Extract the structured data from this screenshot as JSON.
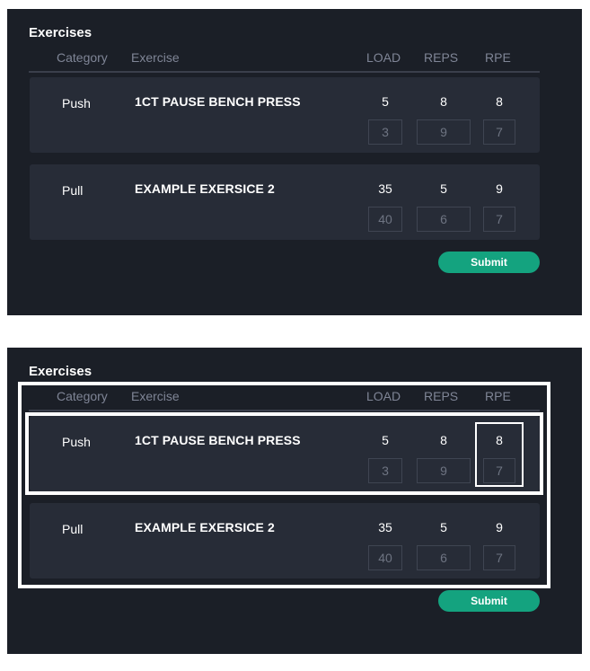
{
  "panels": [
    {
      "title": "Exercises",
      "columns": {
        "category": "Category",
        "exercise": "Exercise",
        "load": "LOAD",
        "reps": "REPS",
        "rpe": "RPE"
      },
      "rows": [
        {
          "category": "Push",
          "exercise": "1CT PAUSE BENCH PRESS",
          "load": "5",
          "reps": "8",
          "rpe": "8",
          "load_input": "3",
          "reps_input": "9",
          "rpe_input": "7"
        },
        {
          "category": "Pull",
          "exercise": "EXAMPLE EXERSICE 2",
          "load": "35",
          "reps": "5",
          "rpe": "9",
          "load_input": "40",
          "reps_input": "6",
          "rpe_input": "7"
        }
      ],
      "submit_label": "Submit"
    },
    {
      "title": "Exercises",
      "columns": {
        "category": "Category",
        "exercise": "Exercise",
        "load": "LOAD",
        "reps": "REPS",
        "rpe": "RPE"
      },
      "rows": [
        {
          "category": "Push",
          "exercise": "1CT PAUSE BENCH PRESS",
          "load": "5",
          "reps": "8",
          "rpe": "8",
          "load_input": "3",
          "reps_input": "9",
          "rpe_input": "7"
        },
        {
          "category": "Pull",
          "exercise": "EXAMPLE EXERSICE 2",
          "load": "35",
          "reps": "5",
          "rpe": "9",
          "load_input": "40",
          "reps_input": "6",
          "rpe_input": "7"
        }
      ],
      "submit_label": "Submit"
    }
  ],
  "colors": {
    "background": "#1b1f27",
    "card": "#272c37",
    "accent": "#14a37f",
    "highlight": "#ffffff"
  }
}
